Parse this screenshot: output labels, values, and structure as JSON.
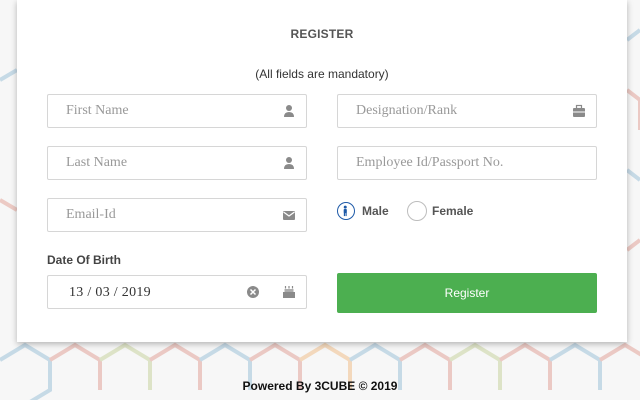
{
  "form": {
    "title": "REGISTER",
    "subtitle": "(All fields are mandatory)",
    "first_name": {
      "placeholder": "First Name",
      "value": ""
    },
    "last_name": {
      "placeholder": "Last Name",
      "value": ""
    },
    "email": {
      "placeholder": "Email-Id",
      "value": ""
    },
    "designation": {
      "placeholder": "Designation/Rank",
      "value": ""
    },
    "employee_id": {
      "placeholder": "Employee Id/Passport No.",
      "value": ""
    },
    "gender": {
      "male_label": "Male",
      "female_label": "Female",
      "selected": "Male"
    },
    "dob": {
      "label": "Date Of Birth",
      "value": "13 / 03 / 2019"
    },
    "register_button": "Register"
  },
  "footer": {
    "text": "Powered By 3CUBE © 2019"
  },
  "colors": {
    "button": "#4caf50",
    "radio_selected": "#1e5aa8",
    "icon": "#8a8a8a"
  },
  "icons": [
    "user-icon",
    "briefcase-icon",
    "envelope-icon",
    "clear-icon",
    "calendar-icon",
    "male-figure-icon"
  ]
}
